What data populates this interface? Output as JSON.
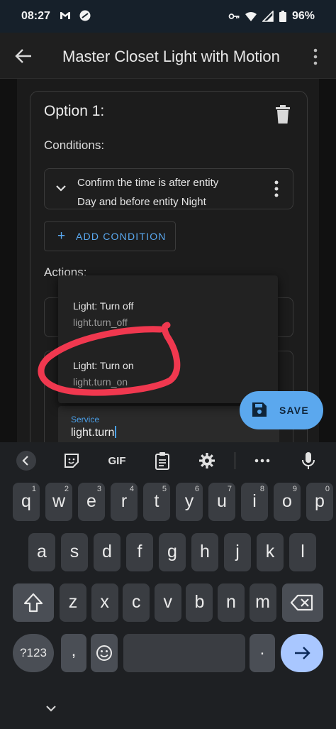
{
  "status": {
    "time": "08:27",
    "battery": "96%",
    "icons": [
      "gmail-icon",
      "sync-off-icon",
      "key-icon",
      "wifi-icon",
      "signal-icon",
      "battery-icon"
    ]
  },
  "appbar": {
    "title": "Master Closet Light with Motion",
    "back_icon": "arrow-left-icon",
    "more_icon": "more-vert-icon"
  },
  "option": {
    "title": "Option 1:",
    "conditions_label": "Conditions:",
    "condition_line1": "Confirm the time is after entity",
    "condition_line2": "Day and before entity Night",
    "add_condition": "ADD CONDITION",
    "actions_label": "Actions:"
  },
  "service_field": {
    "label": "Service",
    "value": "light.turn"
  },
  "dropdown": {
    "items": [
      {
        "name": "Light: Turn off",
        "service": "light.turn_off"
      },
      {
        "name": "Light: Turn on",
        "service": "light.turn_on"
      }
    ]
  },
  "fab": {
    "label": "SAVE"
  },
  "annotation": {
    "color": "#f0384f"
  },
  "keyboard": {
    "toolbar": [
      "chevron-left-icon",
      "sticker-icon",
      "GIF",
      "clipboard-icon",
      "gear-icon",
      "more-horiz-icon",
      "mic-icon"
    ],
    "row1": [
      {
        "k": "q",
        "h": "1"
      },
      {
        "k": "w",
        "h": "2"
      },
      {
        "k": "e",
        "h": "3"
      },
      {
        "k": "r",
        "h": "4"
      },
      {
        "k": "t",
        "h": "5"
      },
      {
        "k": "y",
        "h": "6"
      },
      {
        "k": "u",
        "h": "7"
      },
      {
        "k": "i",
        "h": "8"
      },
      {
        "k": "o",
        "h": "9"
      },
      {
        "k": "p",
        "h": "0"
      }
    ],
    "row2": [
      "a",
      "s",
      "d",
      "f",
      "g",
      "h",
      "j",
      "k",
      "l"
    ],
    "row3": [
      "z",
      "x",
      "c",
      "v",
      "b",
      "n",
      "m"
    ],
    "numbers_key": "?123",
    "comma": ",",
    "period": "."
  }
}
